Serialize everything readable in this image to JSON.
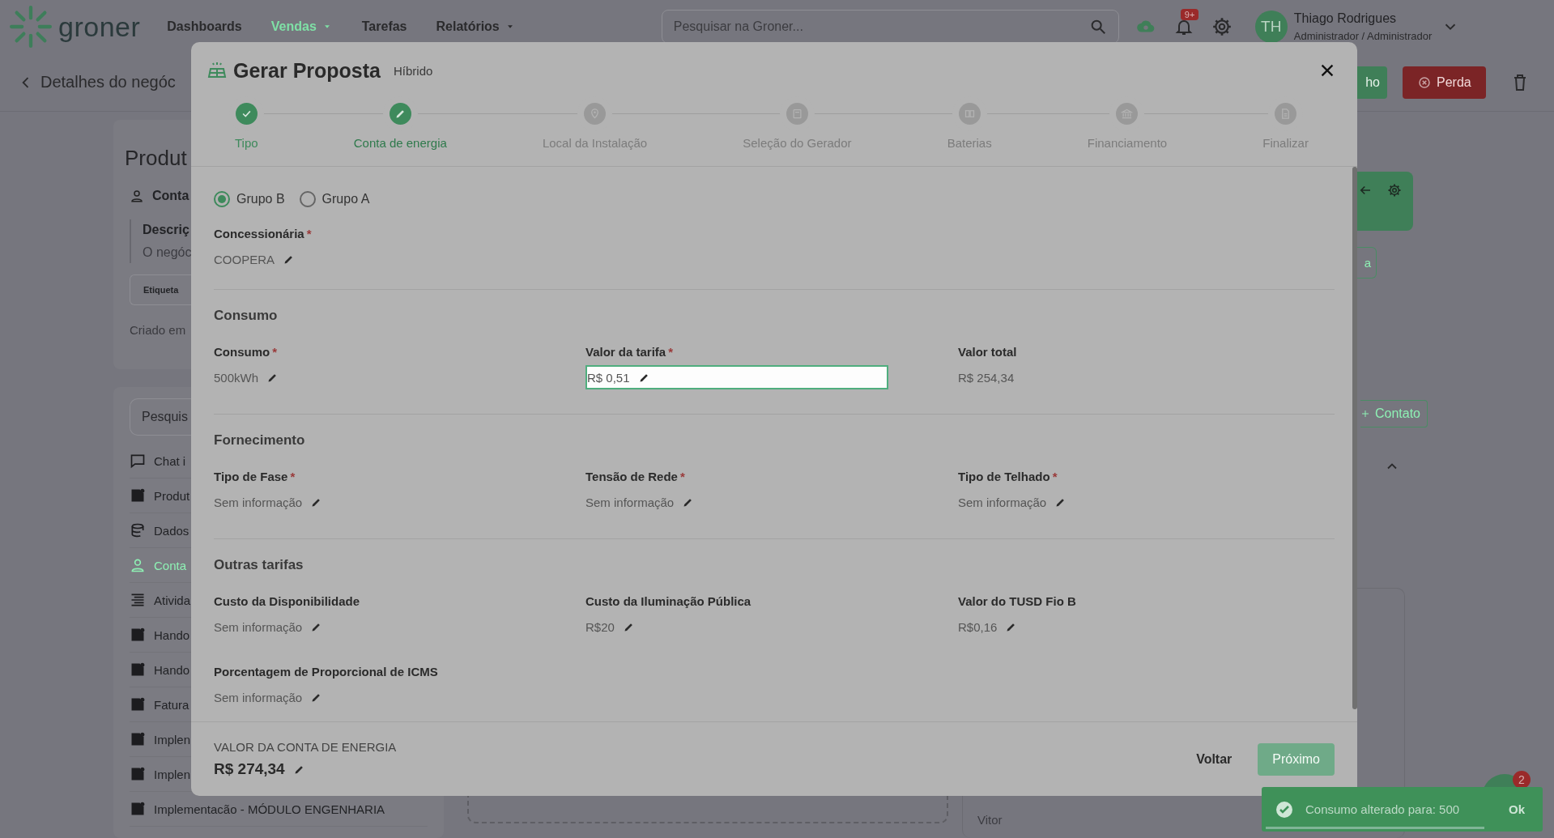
{
  "top_bar": {
    "logo": "groner",
    "nav": [
      {
        "label": "Dashboards",
        "selected": false,
        "has_menu": false
      },
      {
        "label": "Vendas",
        "selected": true,
        "has_menu": true
      },
      {
        "label": "Tarefas",
        "selected": false,
        "has_menu": false
      },
      {
        "label": "Relatórios",
        "selected": false,
        "has_menu": true
      }
    ],
    "search": {
      "placeholder": "Pesquisar na Groner..."
    },
    "notification_badge": "9+",
    "user": {
      "initials": "TH",
      "name": "Thiago Rodrigues",
      "role": "Administrador / Administrador"
    }
  },
  "sub_header": {
    "title": "Detalhes do negóc",
    "buttons": [
      {
        "label": "ho",
        "kind": "success"
      },
      {
        "label": "Perda",
        "kind": "danger"
      }
    ]
  },
  "left_panel": {
    "title": "Produt",
    "contact": "Conta",
    "description_label": "Descriç",
    "description": "O negóc",
    "tag": "Etiqueta",
    "created": "Criado em",
    "search": {
      "placeholder": "Pesquis"
    },
    "menu": [
      {
        "label": "Chat i",
        "selected": false
      },
      {
        "label": "Produt",
        "selected": false
      },
      {
        "label": "Dados",
        "selected": false
      },
      {
        "label": "Conta",
        "selected": true
      },
      {
        "label": "Ativida",
        "selected": false
      },
      {
        "label": "Hando",
        "selected": false
      },
      {
        "label": "Hando",
        "selected": false
      },
      {
        "label": "Fatura",
        "selected": false
      },
      {
        "label": "Implen",
        "selected": false
      },
      {
        "label": "Implen",
        "selected": false
      },
      {
        "label": "Implementacão - MÓDULO ENGENHARIA",
        "selected": false
      }
    ]
  },
  "right_panel": {
    "partial_button": "a",
    "add_contact": "Contato",
    "note_author": "Vitor"
  },
  "modal": {
    "title": "Gerar Proposta",
    "subtitle": "Híbrido",
    "steps": [
      {
        "label": "Tipo",
        "done": true,
        "selected": false
      },
      {
        "label": "Conta de energia",
        "done": false,
        "selected": true
      },
      {
        "label": "Local da Instalação",
        "done": false,
        "selected": false
      },
      {
        "label": "Seleção do Gerador",
        "done": false,
        "selected": false
      },
      {
        "label": "Baterias",
        "done": false,
        "selected": false
      },
      {
        "label": "Financiamento",
        "done": false,
        "selected": false
      },
      {
        "label": "Finalizar",
        "done": false,
        "selected": false
      }
    ],
    "group_options": [
      {
        "label": "Grupo B",
        "selected": true
      },
      {
        "label": "Grupo A",
        "selected": false
      }
    ],
    "utility": {
      "label": "Concessionária",
      "required_mark": "*",
      "value": "COOPERA",
      "editable": true,
      "editing": false
    },
    "sections": [
      {
        "title": "Consumo",
        "fields": [
          {
            "label": "Consumo",
            "required_mark": "*",
            "value": "500kWh",
            "editable": true,
            "editing": false
          },
          {
            "label": "Valor da tarifa",
            "required_mark": "*",
            "value": "R$ 0,51",
            "editable": true,
            "editing": true
          },
          {
            "label": "Valor total",
            "value": "R$ 254,34",
            "editable": false,
            "editing": false
          }
        ]
      },
      {
        "title": "Fornecimento",
        "fields": [
          {
            "label": "Tipo de Fase",
            "required_mark": "*",
            "value": "Sem informação",
            "editable": true,
            "editing": false
          },
          {
            "label": "Tensão de Rede",
            "required_mark": "*",
            "value": "Sem informação",
            "editable": true,
            "editing": false
          },
          {
            "label": "Tipo de Telhado",
            "required_mark": "*",
            "value": "Sem informação",
            "editable": true,
            "editing": false
          }
        ]
      },
      {
        "title": "Outras tarifas",
        "fields": [
          {
            "label": "Custo da Disponibilidade",
            "value": "Sem informação",
            "editable": true,
            "editing": false
          },
          {
            "label": "Custo da Iluminação Pública",
            "value": "R$20",
            "editable": true,
            "editing": false
          },
          {
            "label": "Valor do TUSD Fio B",
            "value": "R$0,16",
            "editable": true,
            "editing": false
          },
          {
            "label": "Porcentagem de Proporcional de ICMS",
            "value": "Sem informação",
            "editable": true,
            "editing": false
          }
        ]
      }
    ],
    "footer": {
      "label": "VALOR DA CONTA DE ENERGIA",
      "value": "R$ 274,34",
      "editable": true
    },
    "back_button": "Voltar",
    "next_button": {
      "label": "Próximo",
      "disabled": true
    }
  },
  "toast": {
    "message": "Consumo alterado para: 500",
    "action": "Ok",
    "level": 0.8
  },
  "chat_badge": "2"
}
